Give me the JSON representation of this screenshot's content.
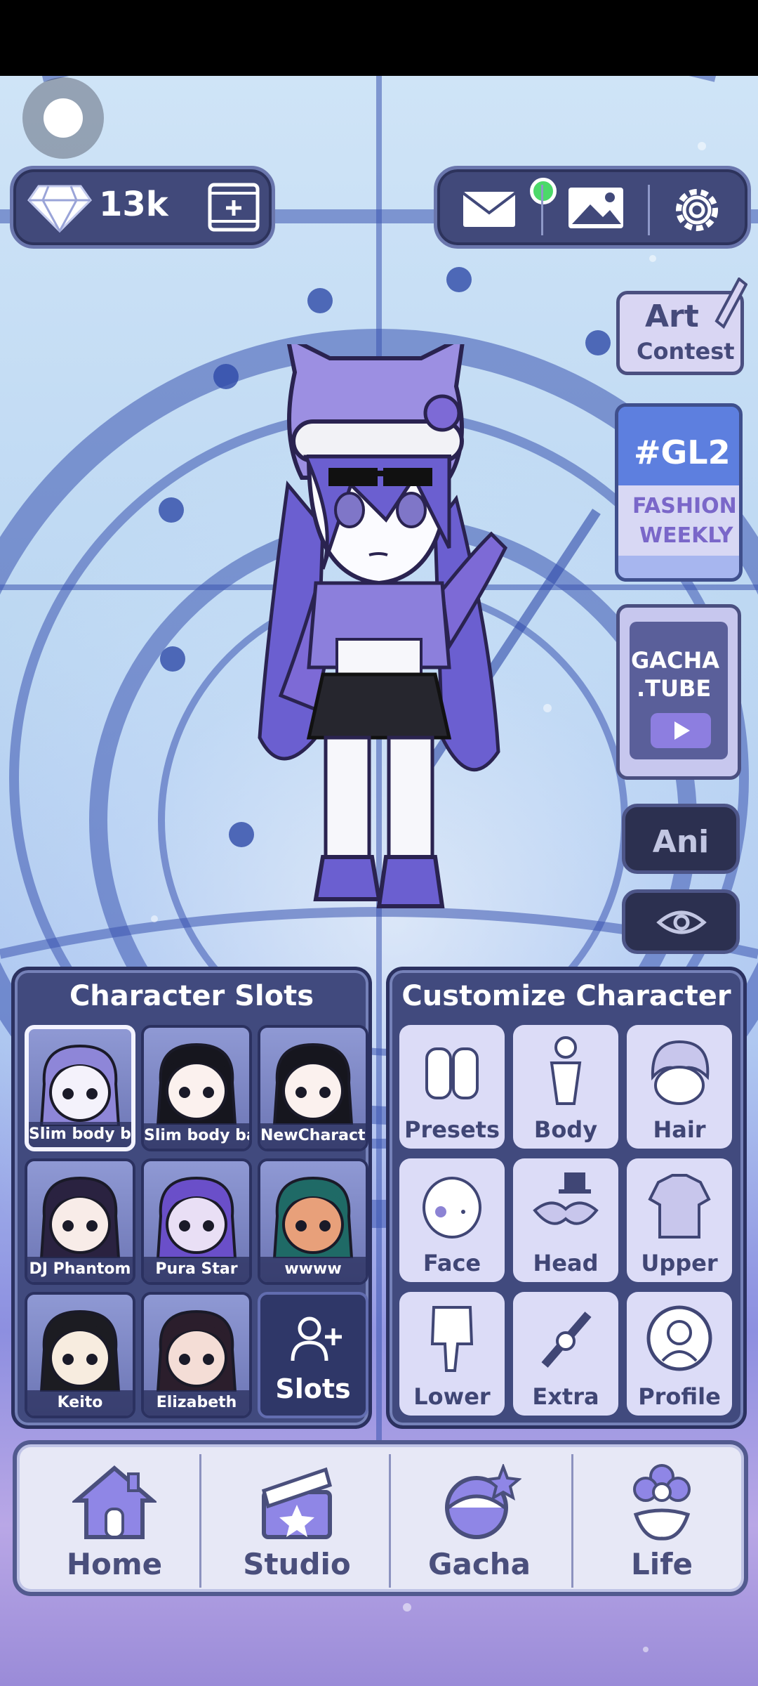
{
  "top": {
    "gems": "13k"
  },
  "side": {
    "art_contest": [
      "Art",
      "Contest"
    ],
    "fashion": [
      "#GL2",
      "FASHION",
      "WEEKLY"
    ],
    "gacha_tube": [
      "GACHA",
      ".TUBE"
    ],
    "ani": "Ani"
  },
  "character_slots": {
    "title": "Character Slots",
    "slots": [
      {
        "name": "Slim body bas"
      },
      {
        "name": "Slim body bas"
      },
      {
        "name": "NewCharacter"
      },
      {
        "name": "DJ Phantom"
      },
      {
        "name": "Pura Star"
      },
      {
        "name": "wwww"
      },
      {
        "name": "Keito"
      },
      {
        "name": "Elizabeth"
      }
    ],
    "add_label": "Slots"
  },
  "customize": {
    "title": "Customize Character",
    "items": [
      "Presets",
      "Body",
      "Hair",
      "Face",
      "Head",
      "Upper",
      "Lower",
      "Extra",
      "Profile"
    ]
  },
  "nav": [
    "Home",
    "Studio",
    "Gacha",
    "Life"
  ],
  "colors": {
    "panel": "#414a7e",
    "panel_border": "#2b3160",
    "tile": "#dcdcf7",
    "notification": "#4cd96a"
  }
}
